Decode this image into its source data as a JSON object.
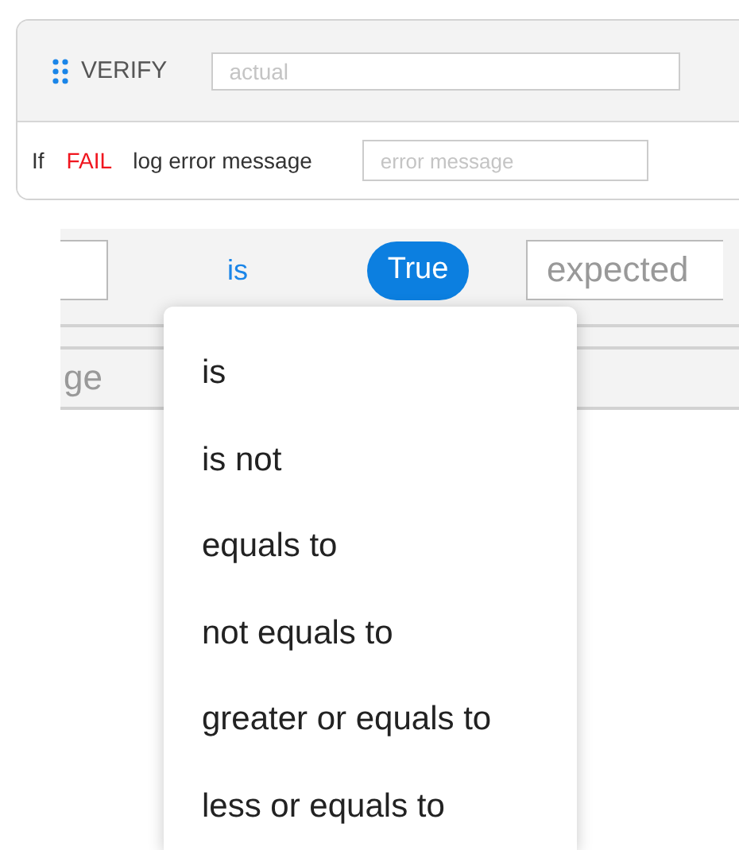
{
  "verify_card": {
    "title": "VERIFY",
    "actual_placeholder": "actual",
    "condition": {
      "prefix": "If",
      "outcome": "FAIL",
      "action": "log error message",
      "message_placeholder": "error message"
    }
  },
  "zoomed_row": {
    "operator": "is",
    "value": "True",
    "expected_placeholder": "expected",
    "message_placeholder": "ge"
  },
  "operator_menu": {
    "items": [
      {
        "label": "is"
      },
      {
        "label": "is not"
      },
      {
        "label": "equals to"
      },
      {
        "label": "not equals to"
      },
      {
        "label": "greater or equals to"
      },
      {
        "label": "less or equals to"
      }
    ]
  }
}
